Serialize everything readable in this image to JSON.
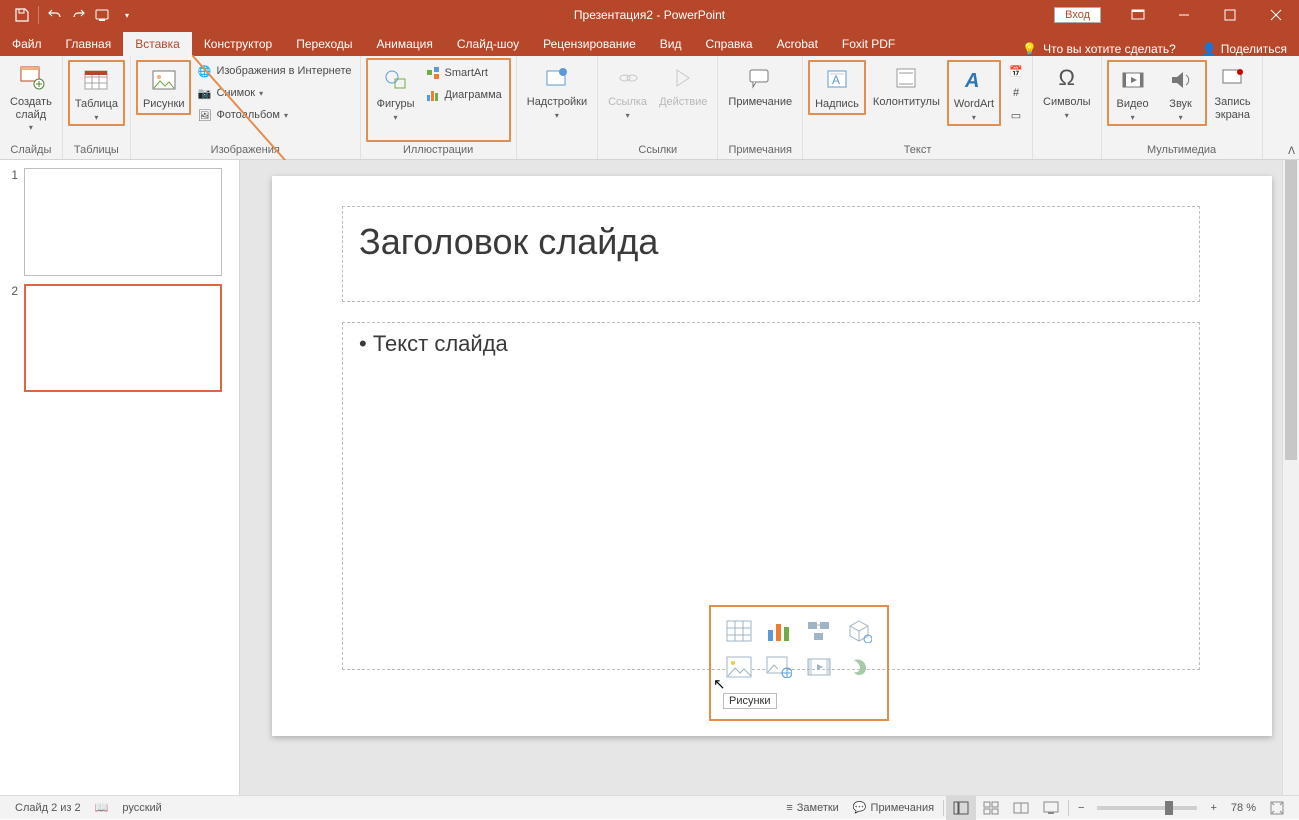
{
  "title": "Презентация2  -  PowerPoint",
  "login": "Вход",
  "share": "Поделиться",
  "tell_me": "Что вы хотите сделать?",
  "tabs": [
    "Файл",
    "Главная",
    "Вставка",
    "Конструктор",
    "Переходы",
    "Анимация",
    "Слайд-шоу",
    "Рецензирование",
    "Вид",
    "Справка",
    "Acrobat",
    "Foxit PDF"
  ],
  "active_tab": 2,
  "ribbon": {
    "groups": {
      "slides": {
        "label": "Слайды",
        "new_slide": "Создать\nслайд"
      },
      "tables": {
        "label": "Таблицы",
        "table": "Таблица"
      },
      "images": {
        "label": "Изображения",
        "pictures": "Рисунки",
        "online": "Изображения в Интернете",
        "screenshot": "Снимок",
        "album": "Фотоальбом"
      },
      "illus": {
        "label": "Иллюстрации",
        "shapes": "Фигуры",
        "smartart": "SmartArt",
        "chart": "Диаграмма"
      },
      "addins": {
        "label": "",
        "addins": "Надстройки"
      },
      "links": {
        "label": "Ссылки",
        "link": "Ссылка",
        "action": "Действие"
      },
      "comments": {
        "label": "Примечания",
        "comment": "Примечание"
      },
      "text": {
        "label": "Текст",
        "textbox": "Надпись",
        "headerfooter": "Колонтитулы",
        "wordart": "WordArt"
      },
      "symbols": {
        "label": "",
        "symbols": "Символы"
      },
      "media": {
        "label": "Мультимедиа",
        "video": "Видео",
        "audio": "Звук",
        "screenrec": "Запись\nэкрана"
      }
    }
  },
  "slide": {
    "title_placeholder": "Заголовок слайда",
    "body_placeholder": "Текст слайда",
    "picker_tooltip": "Рисунки"
  },
  "status": {
    "slide_of": "Слайд 2 из 2",
    "lang": "русский",
    "notes": "Заметки",
    "comments": "Примечания",
    "zoom": "78 %"
  },
  "thumbs": {
    "count": 2,
    "selected": 2
  }
}
